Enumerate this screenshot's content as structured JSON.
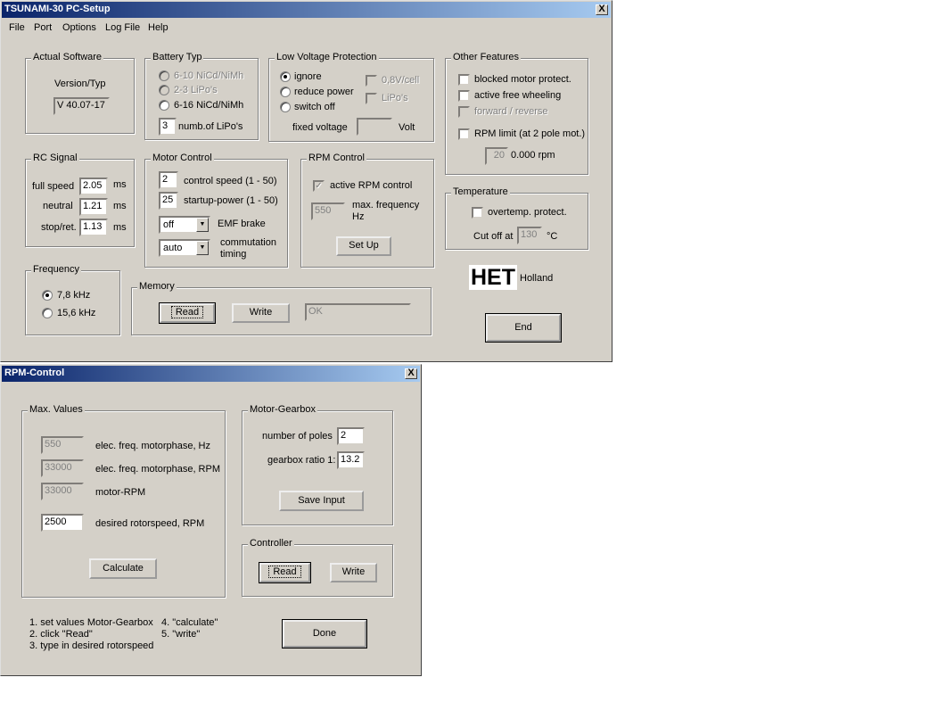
{
  "main": {
    "title": "TSUNAMI-30  PC-Setup",
    "close": "X",
    "menu": [
      "File",
      "Port",
      "Options",
      "Log File",
      "Help"
    ],
    "actual_software": {
      "label": "Actual Software",
      "version_label": "Version/Typ",
      "version": "V 40.07-17"
    },
    "battery": {
      "label": "Battery Typ",
      "opt1": "6-10 NiCd/NiMh",
      "opt2": "2-3 LiPo's",
      "opt3": "6-16 NiCd/NiMh",
      "lipo_count": "3",
      "lipo_label": "numb.of LiPo's"
    },
    "low_voltage": {
      "label": "Low Voltage Protection",
      "opt1": "ignore",
      "opt2": "reduce power",
      "opt3": "switch off",
      "chk1": "0,8V/cell",
      "chk2": "LiPo's",
      "fixed_label": "fixed voltage",
      "fixed_value": "",
      "unit": "Volt"
    },
    "other": {
      "label": "Other Features",
      "f1": "blocked motor protect.",
      "f2": "active free wheeling",
      "f3": "forward / reverse",
      "f4": "RPM limit (at 2 pole mot.)",
      "rpm_value": "20",
      "rpm_text": "0.000 rpm"
    },
    "rc": {
      "label": "RC Signal",
      "full_label": "full speed",
      "full": "2.05",
      "neutral_label": "neutral",
      "neutral": "1.21",
      "stop_label": "stop/ret.",
      "stop": "1.13",
      "unit": "ms"
    },
    "motor": {
      "label": "Motor Control",
      "speed": "2",
      "speed_label": "control speed (1 - 50)",
      "startup": "25",
      "startup_label": "startup-power (1 - 50)",
      "emf": "off",
      "emf_label": "EMF brake",
      "timing": "auto",
      "timing_label1": "commutation",
      "timing_label2": "timing"
    },
    "rpm": {
      "label": "RPM Control",
      "active_label": "active RPM control",
      "freq": "550",
      "freq_label1": "max. frequency",
      "freq_label2": "Hz",
      "setup": "Set Up"
    },
    "temp": {
      "label": "Temperature",
      "over_label": "overtemp. protect.",
      "cut_label": "Cut off at",
      "cut": "130",
      "unit": "°C"
    },
    "freq": {
      "label": "Frequency",
      "opt1": "7,8 kHz",
      "opt2": "15,6 kHz"
    },
    "memory": {
      "label": "Memory",
      "read": "Read",
      "write": "Write",
      "status": "OK"
    },
    "logo": "HET",
    "logo_sub": "Holland",
    "end": "End"
  },
  "rpm_dialog": {
    "title": "RPM-Control",
    "close": "X",
    "max": {
      "label": "Max. Values",
      "v1": "550",
      "l1": "elec. freq. motorphase, Hz",
      "v2": "33000",
      "l2": "elec. freq. motorphase, RPM",
      "v3": "33000",
      "l3": "motor-RPM",
      "v4": "2500",
      "l4": "desired rotorspeed, RPM",
      "calc": "Calculate"
    },
    "gear": {
      "label": "Motor-Gearbox",
      "poles_label": "number of poles",
      "poles": "2",
      "ratio_label": "gearbox ratio 1:",
      "ratio": "13.2",
      "save": "Save Input"
    },
    "ctrl": {
      "label": "Controller",
      "read": "Read",
      "write": "Write"
    },
    "instructions": {
      "i1": "1. set values Motor-Gearbox",
      "i2": "2. click \"Read\"",
      "i3": "3. type in desired rotorspeed",
      "i4": "4. \"calculate\"",
      "i5": "5. \"write\""
    },
    "done": "Done"
  }
}
